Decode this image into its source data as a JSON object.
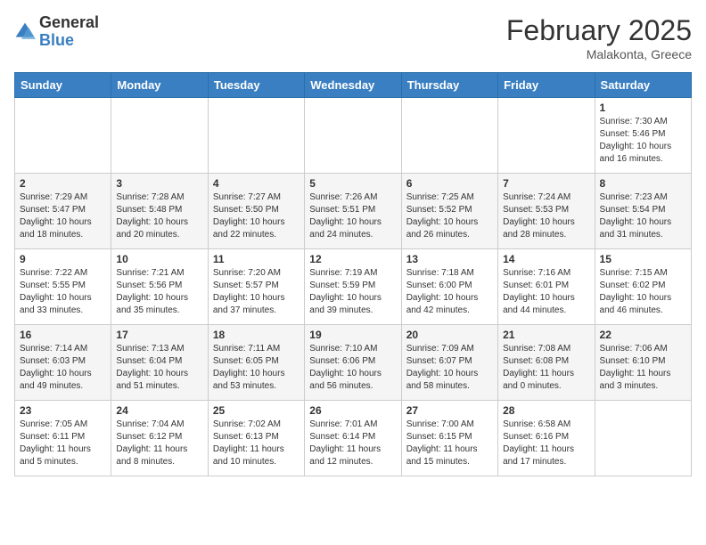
{
  "header": {
    "logo": {
      "line1": "General",
      "line2": "Blue"
    },
    "title": "February 2025",
    "subtitle": "Malakonta, Greece"
  },
  "weekdays": [
    "Sunday",
    "Monday",
    "Tuesday",
    "Wednesday",
    "Thursday",
    "Friday",
    "Saturday"
  ],
  "weeks": [
    [
      {
        "day": "",
        "info": ""
      },
      {
        "day": "",
        "info": ""
      },
      {
        "day": "",
        "info": ""
      },
      {
        "day": "",
        "info": ""
      },
      {
        "day": "",
        "info": ""
      },
      {
        "day": "",
        "info": ""
      },
      {
        "day": "1",
        "info": "Sunrise: 7:30 AM\nSunset: 5:46 PM\nDaylight: 10 hours and 16 minutes."
      }
    ],
    [
      {
        "day": "2",
        "info": "Sunrise: 7:29 AM\nSunset: 5:47 PM\nDaylight: 10 hours and 18 minutes."
      },
      {
        "day": "3",
        "info": "Sunrise: 7:28 AM\nSunset: 5:48 PM\nDaylight: 10 hours and 20 minutes."
      },
      {
        "day": "4",
        "info": "Sunrise: 7:27 AM\nSunset: 5:50 PM\nDaylight: 10 hours and 22 minutes."
      },
      {
        "day": "5",
        "info": "Sunrise: 7:26 AM\nSunset: 5:51 PM\nDaylight: 10 hours and 24 minutes."
      },
      {
        "day": "6",
        "info": "Sunrise: 7:25 AM\nSunset: 5:52 PM\nDaylight: 10 hours and 26 minutes."
      },
      {
        "day": "7",
        "info": "Sunrise: 7:24 AM\nSunset: 5:53 PM\nDaylight: 10 hours and 28 minutes."
      },
      {
        "day": "8",
        "info": "Sunrise: 7:23 AM\nSunset: 5:54 PM\nDaylight: 10 hours and 31 minutes."
      }
    ],
    [
      {
        "day": "9",
        "info": "Sunrise: 7:22 AM\nSunset: 5:55 PM\nDaylight: 10 hours and 33 minutes."
      },
      {
        "day": "10",
        "info": "Sunrise: 7:21 AM\nSunset: 5:56 PM\nDaylight: 10 hours and 35 minutes."
      },
      {
        "day": "11",
        "info": "Sunrise: 7:20 AM\nSunset: 5:57 PM\nDaylight: 10 hours and 37 minutes."
      },
      {
        "day": "12",
        "info": "Sunrise: 7:19 AM\nSunset: 5:59 PM\nDaylight: 10 hours and 39 minutes."
      },
      {
        "day": "13",
        "info": "Sunrise: 7:18 AM\nSunset: 6:00 PM\nDaylight: 10 hours and 42 minutes."
      },
      {
        "day": "14",
        "info": "Sunrise: 7:16 AM\nSunset: 6:01 PM\nDaylight: 10 hours and 44 minutes."
      },
      {
        "day": "15",
        "info": "Sunrise: 7:15 AM\nSunset: 6:02 PM\nDaylight: 10 hours and 46 minutes."
      }
    ],
    [
      {
        "day": "16",
        "info": "Sunrise: 7:14 AM\nSunset: 6:03 PM\nDaylight: 10 hours and 49 minutes."
      },
      {
        "day": "17",
        "info": "Sunrise: 7:13 AM\nSunset: 6:04 PM\nDaylight: 10 hours and 51 minutes."
      },
      {
        "day": "18",
        "info": "Sunrise: 7:11 AM\nSunset: 6:05 PM\nDaylight: 10 hours and 53 minutes."
      },
      {
        "day": "19",
        "info": "Sunrise: 7:10 AM\nSunset: 6:06 PM\nDaylight: 10 hours and 56 minutes."
      },
      {
        "day": "20",
        "info": "Sunrise: 7:09 AM\nSunset: 6:07 PM\nDaylight: 10 hours and 58 minutes."
      },
      {
        "day": "21",
        "info": "Sunrise: 7:08 AM\nSunset: 6:08 PM\nDaylight: 11 hours and 0 minutes."
      },
      {
        "day": "22",
        "info": "Sunrise: 7:06 AM\nSunset: 6:10 PM\nDaylight: 11 hours and 3 minutes."
      }
    ],
    [
      {
        "day": "23",
        "info": "Sunrise: 7:05 AM\nSunset: 6:11 PM\nDaylight: 11 hours and 5 minutes."
      },
      {
        "day": "24",
        "info": "Sunrise: 7:04 AM\nSunset: 6:12 PM\nDaylight: 11 hours and 8 minutes."
      },
      {
        "day": "25",
        "info": "Sunrise: 7:02 AM\nSunset: 6:13 PM\nDaylight: 11 hours and 10 minutes."
      },
      {
        "day": "26",
        "info": "Sunrise: 7:01 AM\nSunset: 6:14 PM\nDaylight: 11 hours and 12 minutes."
      },
      {
        "day": "27",
        "info": "Sunrise: 7:00 AM\nSunset: 6:15 PM\nDaylight: 11 hours and 15 minutes."
      },
      {
        "day": "28",
        "info": "Sunrise: 6:58 AM\nSunset: 6:16 PM\nDaylight: 11 hours and 17 minutes."
      },
      {
        "day": "",
        "info": ""
      }
    ]
  ]
}
